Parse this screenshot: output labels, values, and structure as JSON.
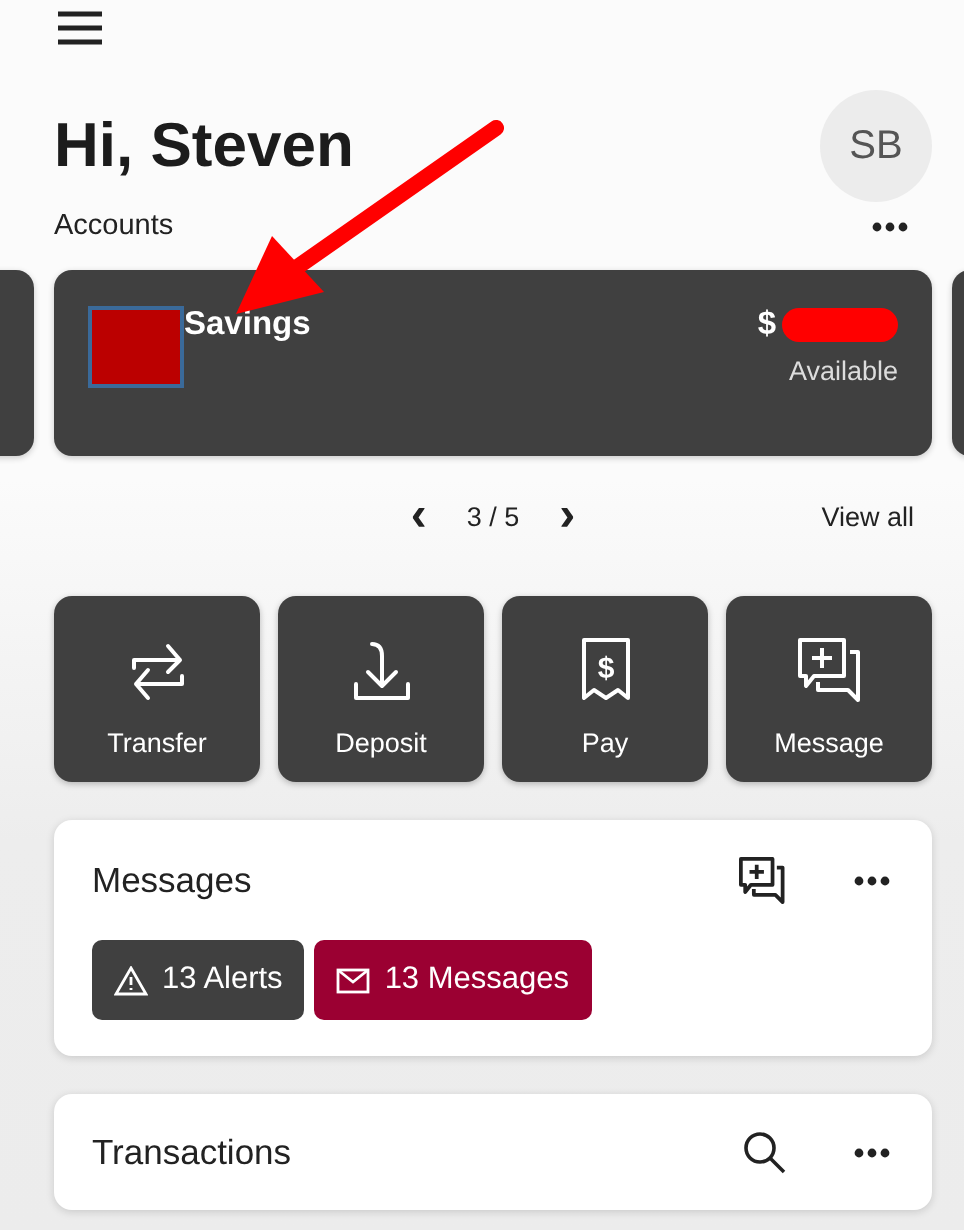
{
  "header": {
    "greeting": "Hi, Steven",
    "avatar": "SB"
  },
  "accounts": {
    "title": "Accounts",
    "card": {
      "name": "Savings",
      "balance": "$",
      "balance_label": "Available"
    },
    "pager": {
      "prev": "‹",
      "position": "3 / 5",
      "next": "›"
    },
    "view_all": "View all"
  },
  "actions": [
    {
      "kind": "transfer",
      "label": "Transfer"
    },
    {
      "kind": "deposit",
      "label": "Deposit"
    },
    {
      "kind": "pay",
      "label": "Pay",
      "glyph": "$"
    },
    {
      "kind": "message",
      "label": "Message"
    }
  ],
  "messages": {
    "title": "Messages",
    "badges": [
      {
        "kind": "alerts",
        "label": "13 Alerts",
        "color": "#404040"
      },
      {
        "kind": "messages",
        "label": "13 Messages",
        "color": "#9b0032"
      }
    ]
  },
  "transactions": {
    "title": "Transactions"
  }
}
